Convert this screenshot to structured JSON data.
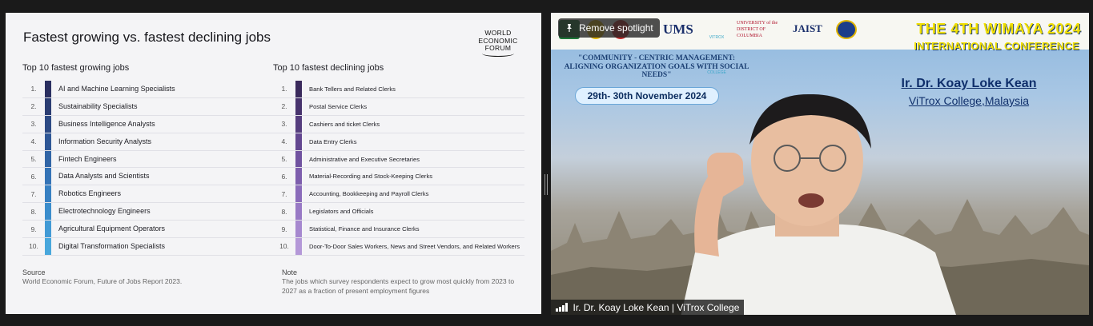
{
  "slide": {
    "title": "Fastest growing vs. fastest declining jobs",
    "logo_lines": [
      "WORLD",
      "ECONOMIC",
      "FORUM"
    ],
    "growing": {
      "heading": "Top 10 fastest growing jobs",
      "rows": [
        {
          "num": "1.",
          "label": "AI and Machine Learning Specialists",
          "color": "#2a2f60"
        },
        {
          "num": "2.",
          "label": "Sustainability Specialists",
          "color": "#2b3d72"
        },
        {
          "num": "3.",
          "label": "Business Intelligence Analysts",
          "color": "#2d4a84"
        },
        {
          "num": "4.",
          "label": "Information Security Analysts",
          "color": "#2f5796"
        },
        {
          "num": "5.",
          "label": "Fintech Engineers",
          "color": "#3165a6"
        },
        {
          "num": "6.",
          "label": "Data Analysts and Scientists",
          "color": "#3473b6"
        },
        {
          "num": "7.",
          "label": "Robotics Engineers",
          "color": "#3780c2"
        },
        {
          "num": "8.",
          "label": "Electrotechnology Engineers",
          "color": "#3b8dcc"
        },
        {
          "num": "9.",
          "label": "Agricultural Equipment Operators",
          "color": "#419ad5"
        },
        {
          "num": "10.",
          "label": "Digital Transformation Specialists",
          "color": "#48a7dc"
        }
      ]
    },
    "declining": {
      "heading": "Top 10 fastest declining jobs",
      "rows": [
        {
          "num": "1.",
          "label": "Bank Tellers and Related Clerks",
          "color": "#3a2a5c"
        },
        {
          "num": "2.",
          "label": "Postal Service Clerks",
          "color": "#47336d"
        },
        {
          "num": "3.",
          "label": "Cashiers and ticket Clerks",
          "color": "#553d7e"
        },
        {
          "num": "4.",
          "label": "Data Entry Clerks",
          "color": "#634790"
        },
        {
          "num": "5.",
          "label": "Administrative and Executive Secretaries",
          "color": "#7052a0"
        },
        {
          "num": "6.",
          "label": "Material-Recording and Stock-Keeping Clerks",
          "color": "#7d5ead"
        },
        {
          "num": "7.",
          "label": "Accounting, Bookkeeping and Payroll Clerks",
          "color": "#8a6bba"
        },
        {
          "num": "8.",
          "label": "Legislators and Officials",
          "color": "#9879c5"
        },
        {
          "num": "9.",
          "label": "Statistical, Finance and Insurance Clerks",
          "color": "#a688cf"
        },
        {
          "num": "10.",
          "label": "Door-To-Door Sales Workers, News and Street Vendors, and Related Workers",
          "color": "#b498d8"
        }
      ]
    },
    "source_title": "Source",
    "source_text": "World Economic Forum, Future of Jobs Report 2023.",
    "note_title": "Note",
    "note_text": "The jobs which survey respondents expect to grow most quickly from 2023 to 2027 as a fraction of present employment figures"
  },
  "video": {
    "spotlight_label": "Remove spotlight",
    "conference_title": "THE 4TH WIMAYA 2024",
    "conference_subtitle": "INTERNATIONAL CONFERENCE",
    "theme": "\"COMMUNITY - CENTRIC MANAGEMENT: ALIGNING ORGANIZATION GOALS WITH SOCIAL NEEDS\"",
    "dates": "29th- 30th November 2024",
    "speaker_name": "Ir. Dr. Koay Loke Kean",
    "speaker_org": "ViTrox College,Malaysia",
    "participant_name": "Ir. Dr. Koay Loke Kean | ViTrox College",
    "banner_logos": [
      "UMS",
      "VITROX COLLEGE",
      "UNIVERSITY of the DISTRICT OF COLUMBIA",
      "JAIST"
    ]
  }
}
